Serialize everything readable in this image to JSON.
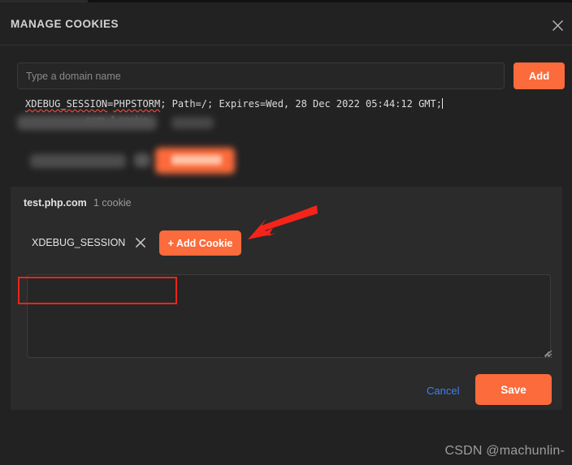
{
  "window": {
    "title": "MANAGE COOKIES",
    "close_icon": "close-icon"
  },
  "domain_add": {
    "input_value": "",
    "placeholder": "Type a domain name",
    "add_label": "Add"
  },
  "redacted_rows": [
    {
      "visible_text": "…com",
      "count": "1 cookie",
      "note": "blurred"
    },
    {
      "visible_text": "",
      "button": "+ Add Cookie",
      "note": "blurred"
    }
  ],
  "active_domain": {
    "name": "test.php.com",
    "count": "1 cookie",
    "cookie_name": "XDEBUG_SESSION",
    "remove_icon": "close-icon",
    "add_cookie_label": "+ Add Cookie"
  },
  "cookie_editor": {
    "value": "XDEBUG_SESSION=PHPSTORM; Path=/; Expires=Wed, 28 Dec 2022 05:44:12 GMT;",
    "highlighted_part": "XDEBUG_SESSION=PHPSTORM;",
    "rest_part": " Path=/; Expires=Wed, 28 Dec 2022 05:44:12 GMT;",
    "misspelled_1": "XDEBUG_SESSION",
    "separator_1": "=",
    "misspelled_2": "PHPSTORM",
    "after_2": ";"
  },
  "footer": {
    "cancel_label": "Cancel",
    "save_label": "Save"
  },
  "annotation": {
    "arrow_color": "#f4241b",
    "box_color": "#e8261a"
  },
  "watermark": {
    "text": "CSDN @machunlin-"
  },
  "colors": {
    "accent_orange": "#fb6b3b",
    "link_blue": "#3c82f0",
    "panel_bg": "#2b2b2b",
    "modal_bg": "#222222"
  }
}
